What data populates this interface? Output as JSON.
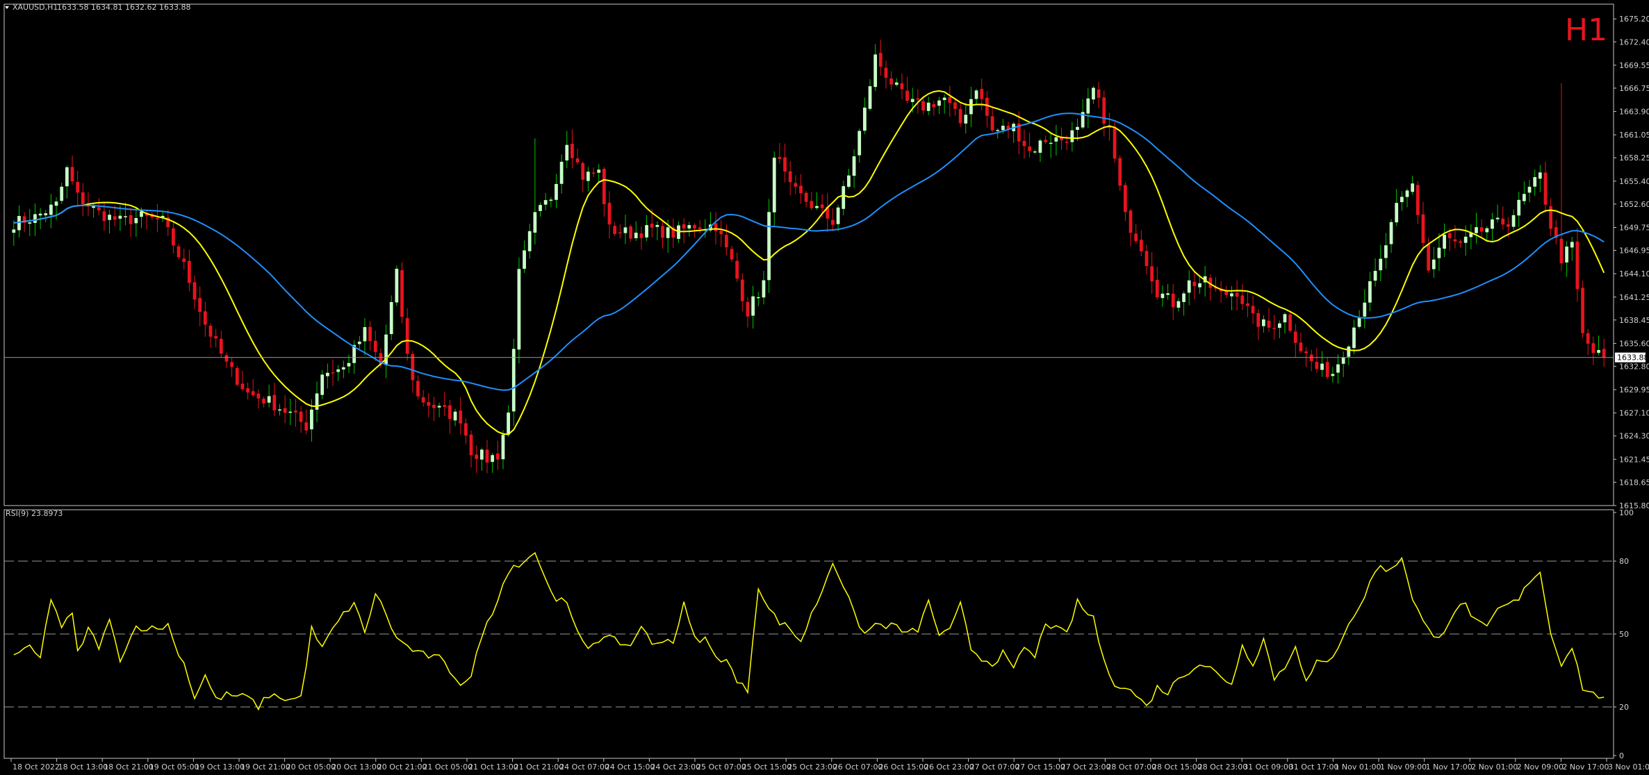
{
  "chart_data": [
    {
      "type": "candlestick",
      "header": {
        "symbol": "XAUUSD,H1",
        "ohlc_text": "1633.58 1634.81 1632.62 1633.88"
      },
      "timeframe_label": "H1",
      "last_price_label": "1633.88",
      "last_price": 1633.88,
      "ylim": [
        1615.8,
        1677.0
      ],
      "y_ticks": [
        "1675.20",
        "1672.40",
        "1669.55",
        "1666.75",
        "1663.90",
        "1661.05",
        "1658.25",
        "1655.40",
        "1652.60",
        "1649.75",
        "1646.95",
        "1644.10",
        "1641.25",
        "1638.45",
        "1635.60",
        "1632.80",
        "1629.95",
        "1627.10",
        "1624.30",
        "1621.45",
        "1618.65",
        "1615.80"
      ],
      "x_ticks": [
        "18 Oct 2022",
        "18 Oct 13:00",
        "18 Oct 21:00",
        "19 Oct 05:00",
        "19 Oct 13:00",
        "19 Oct 21:00",
        "20 Oct 05:00",
        "20 Oct 13:00",
        "20 Oct 21:00",
        "21 Oct 05:00",
        "21 Oct 13:00",
        "21 Oct 21:00",
        "24 Oct 07:00",
        "24 Oct 15:00",
        "24 Oct 23:00",
        "25 Oct 07:00",
        "25 Oct 15:00",
        "25 Oct 23:00",
        "26 Oct 07:00",
        "26 Oct 15:00",
        "26 Oct 23:00",
        "27 Oct 07:00",
        "27 Oct 15:00",
        "27 Oct 23:00",
        "28 Oct 07:00",
        "28 Oct 15:00",
        "28 Oct 23:00",
        "31 Oct 09:00",
        "31 Oct 17:00",
        "1 Nov 01:00",
        "1 Nov 09:00",
        "1 Nov 17:00",
        "2 Nov 01:00",
        "2 Nov 09:00",
        "2 Nov 17:00",
        "3 Nov 01:00"
      ],
      "close_anchors": [
        [
          0,
          1650.3
        ],
        [
          4,
          1651.0
        ],
        [
          8,
          1652.5
        ],
        [
          10,
          1656.8
        ],
        [
          12,
          1653.5
        ],
        [
          16,
          1651.5
        ],
        [
          20,
          1650.5
        ],
        [
          24,
          1651.0
        ],
        [
          28,
          1650.5
        ],
        [
          32,
          1645.0
        ],
        [
          36,
          1638.0
        ],
        [
          40,
          1633.0
        ],
        [
          44,
          1629.5
        ],
        [
          48,
          1628.5
        ],
        [
          52,
          1627.0
        ],
        [
          55,
          1625.5
        ],
        [
          58,
          1632.0
        ],
        [
          62,
          1632.5
        ],
        [
          66,
          1637.0
        ],
        [
          69,
          1633.0
        ],
        [
          72,
          1644.0
        ],
        [
          74,
          1634.0
        ],
        [
          76,
          1629.0
        ],
        [
          80,
          1627.5
        ],
        [
          84,
          1626.5
        ],
        [
          86,
          1622.5
        ],
        [
          89,
          1621.5
        ],
        [
          91,
          1622.0
        ],
        [
          93,
          1627.0
        ],
        [
          95,
          1644.0
        ],
        [
          98,
          1651.0
        ],
        [
          101,
          1653.5
        ],
        [
          104,
          1660.5
        ],
        [
          107,
          1656.0
        ],
        [
          110,
          1656.5
        ],
        [
          112,
          1649.5
        ],
        [
          116,
          1649.0
        ],
        [
          120,
          1649.5
        ],
        [
          124,
          1649.0
        ],
        [
          128,
          1650.0
        ],
        [
          132,
          1650.0
        ],
        [
          135,
          1645.5
        ],
        [
          138,
          1639.5
        ],
        [
          141,
          1643.0
        ],
        [
          143,
          1659.0
        ],
        [
          146,
          1654.5
        ],
        [
          150,
          1652.5
        ],
        [
          154,
          1650.5
        ],
        [
          157,
          1656.0
        ],
        [
          160,
          1664.0
        ],
        [
          162,
          1670.5
        ],
        [
          165,
          1667.5
        ],
        [
          168,
          1665.0
        ],
        [
          171,
          1664.5
        ],
        [
          175,
          1665.5
        ],
        [
          178,
          1662.5
        ],
        [
          181,
          1667.0
        ],
        [
          184,
          1661.5
        ],
        [
          188,
          1662.0
        ],
        [
          191,
          1659.0
        ],
        [
          194,
          1660.5
        ],
        [
          197,
          1660.5
        ],
        [
          200,
          1661.5
        ],
        [
          203,
          1666.5
        ],
        [
          206,
          1661.5
        ],
        [
          209,
          1651.0
        ],
        [
          212,
          1647.5
        ],
        [
          215,
          1642.0
        ],
        [
          218,
          1640.5
        ],
        [
          221,
          1643.0
        ],
        [
          224,
          1643.0
        ],
        [
          227,
          1641.5
        ],
        [
          230,
          1642.0
        ],
        [
          233,
          1638.5
        ],
        [
          236,
          1637.5
        ],
        [
          239,
          1639.0
        ],
        [
          242,
          1635.0
        ],
        [
          245,
          1632.5
        ],
        [
          248,
          1632.0
        ],
        [
          251,
          1636.0
        ],
        [
          254,
          1641.0
        ],
        [
          257,
          1645.5
        ],
        [
          260,
          1652.0
        ],
        [
          263,
          1655.0
        ],
        [
          266,
          1644.5
        ],
        [
          269,
          1648.5
        ],
        [
          272,
          1647.5
        ],
        [
          275,
          1649.0
        ],
        [
          278,
          1650.0
        ],
        [
          281,
          1650.5
        ],
        [
          284,
          1653.5
        ],
        [
          287,
          1656.0
        ],
        [
          289,
          1650.0
        ],
        [
          291,
          1646.0
        ],
        [
          293,
          1647.5
        ],
        [
          295,
          1636.5
        ],
        [
          297,
          1634.5
        ],
        [
          299,
          1633.88
        ]
      ],
      "series": [
        {
          "name": "",
          "color": "#ffff00"
        },
        {
          "name": "",
          "color": "#1e90ff"
        }
      ]
    },
    {
      "type": "line",
      "label": "RSI(9) 23.8973",
      "ylim": [
        0,
        100
      ],
      "y_ticks": [
        "100",
        "80",
        "50",
        "20",
        "0"
      ],
      "levels": [
        80,
        50,
        20
      ],
      "color": "#ffff00",
      "anchors": [
        [
          0,
          42
        ],
        [
          3,
          44
        ],
        [
          5,
          40
        ],
        [
          7,
          65
        ],
        [
          9,
          53
        ],
        [
          11,
          58
        ],
        [
          12,
          42
        ],
        [
          14,
          52
        ],
        [
          16,
          45
        ],
        [
          18,
          55
        ],
        [
          20,
          40
        ],
        [
          23,
          53
        ],
        [
          27,
          52
        ],
        [
          29,
          54
        ],
        [
          30,
          47
        ],
        [
          32,
          38
        ],
        [
          34,
          24
        ],
        [
          36,
          33
        ],
        [
          38,
          23
        ],
        [
          40,
          25
        ],
        [
          44,
          24
        ],
        [
          46,
          20
        ],
        [
          48,
          25
        ],
        [
          52,
          23
        ],
        [
          54,
          24
        ],
        [
          56,
          52
        ],
        [
          58,
          44
        ],
        [
          60,
          52
        ],
        [
          62,
          58
        ],
        [
          64,
          63
        ],
        [
          66,
          50
        ],
        [
          68,
          67
        ],
        [
          70,
          58
        ],
        [
          72,
          48
        ],
        [
          76,
          42
        ],
        [
          80,
          40
        ],
        [
          84,
          30
        ],
        [
          86,
          32
        ],
        [
          88,
          50
        ],
        [
          90,
          58
        ],
        [
          92,
          72
        ],
        [
          94,
          78
        ],
        [
          96,
          80
        ],
        [
          98,
          84
        ],
        [
          100,
          72
        ],
        [
          102,
          65
        ],
        [
          104,
          62
        ],
        [
          106,
          50
        ],
        [
          108,
          45
        ],
        [
          110,
          48
        ],
        [
          112,
          48
        ],
        [
          116,
          45
        ],
        [
          118,
          54
        ],
        [
          120,
          45
        ],
        [
          122,
          48
        ],
        [
          124,
          47
        ],
        [
          126,
          62
        ],
        [
          128,
          48
        ],
        [
          130,
          48
        ],
        [
          132,
          40
        ],
        [
          134,
          40
        ],
        [
          136,
          30
        ],
        [
          138,
          27
        ],
        [
          140,
          70
        ],
        [
          142,
          60
        ],
        [
          144,
          55
        ],
        [
          146,
          52
        ],
        [
          148,
          47
        ],
        [
          150,
          58
        ],
        [
          152,
          68
        ],
        [
          154,
          80
        ],
        [
          156,
          70
        ],
        [
          158,
          58
        ],
        [
          160,
          50
        ],
        [
          162,
          54
        ],
        [
          166,
          53
        ],
        [
          168,
          50
        ],
        [
          170,
          52
        ],
        [
          172,
          63
        ],
        [
          174,
          50
        ],
        [
          176,
          51
        ],
        [
          178,
          62
        ],
        [
          180,
          44
        ],
        [
          182,
          40
        ],
        [
          184,
          38
        ],
        [
          186,
          42
        ],
        [
          188,
          35
        ],
        [
          190,
          45
        ],
        [
          192,
          40
        ],
        [
          194,
          55
        ],
        [
          196,
          52
        ],
        [
          198,
          50
        ],
        [
          200,
          63
        ],
        [
          202,
          58
        ],
        [
          203,
          57
        ],
        [
          205,
          38
        ],
        [
          207,
          30
        ],
        [
          209,
          28
        ],
        [
          211,
          25
        ],
        [
          213,
          20
        ],
        [
          215,
          28
        ],
        [
          217,
          26
        ],
        [
          219,
          32
        ],
        [
          221,
          35
        ],
        [
          223,
          38
        ],
        [
          225,
          36
        ],
        [
          227,
          32
        ],
        [
          229,
          30
        ],
        [
          231,
          45
        ],
        [
          233,
          38
        ],
        [
          235,
          48
        ],
        [
          237,
          32
        ],
        [
          239,
          36
        ],
        [
          241,
          46
        ],
        [
          243,
          30
        ],
        [
          245,
          38
        ],
        [
          247,
          38
        ],
        [
          249,
          45
        ],
        [
          251,
          55
        ],
        [
          253,
          60
        ],
        [
          255,
          72
        ],
        [
          257,
          78
        ],
        [
          259,
          76
        ],
        [
          261,
          82
        ],
        [
          263,
          65
        ],
        [
          265,
          55
        ],
        [
          267,
          48
        ],
        [
          269,
          52
        ],
        [
          271,
          60
        ],
        [
          273,
          62
        ],
        [
          275,
          55
        ],
        [
          277,
          52
        ],
        [
          279,
          60
        ],
        [
          281,
          62
        ],
        [
          283,
          64
        ],
        [
          285,
          72
        ],
        [
          287,
          76
        ],
        [
          289,
          50
        ],
        [
          291,
          38
        ],
        [
          293,
          45
        ],
        [
          295,
          28
        ],
        [
          297,
          25
        ],
        [
          299,
          24
        ]
      ]
    }
  ]
}
